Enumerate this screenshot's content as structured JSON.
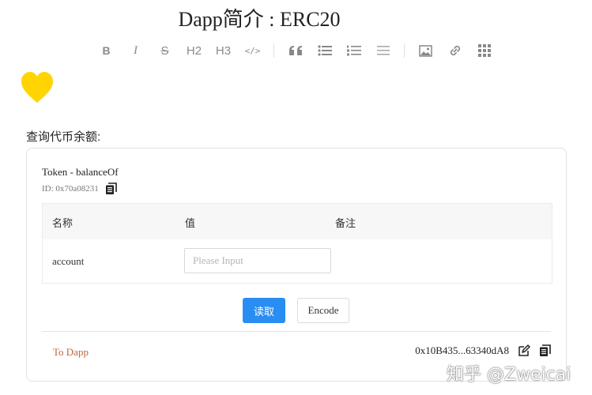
{
  "page": {
    "title": "Dapp简介 : ERC20"
  },
  "toolbar": {
    "items": [
      {
        "name": "bold",
        "glyph": "B"
      },
      {
        "name": "italic",
        "glyph": "I"
      },
      {
        "name": "strikethrough",
        "glyph": "S"
      },
      {
        "name": "heading-2",
        "glyph": "H2"
      },
      {
        "name": "heading-3",
        "glyph": "H3"
      },
      {
        "name": "code",
        "glyph": "</>"
      }
    ]
  },
  "section": {
    "label": "查询代币余额:"
  },
  "card": {
    "function_name": "Token - balanceOf",
    "function_id": "ID: 0x70a08231",
    "table": {
      "headers": [
        "名称",
        "值",
        "备注"
      ],
      "rows": [
        {
          "name": "account",
          "placeholder": "Please Input",
          "value": ""
        }
      ]
    },
    "read_button": "读取",
    "encode_button": "Encode",
    "to_dapp_link": "To Dapp",
    "address": "0x10B435...63340dA8"
  },
  "watermark": "知乎 @Zweicai",
  "colors": {
    "primary": "#2a8df2",
    "link": "#c0653a",
    "heart": "#ffd400"
  }
}
